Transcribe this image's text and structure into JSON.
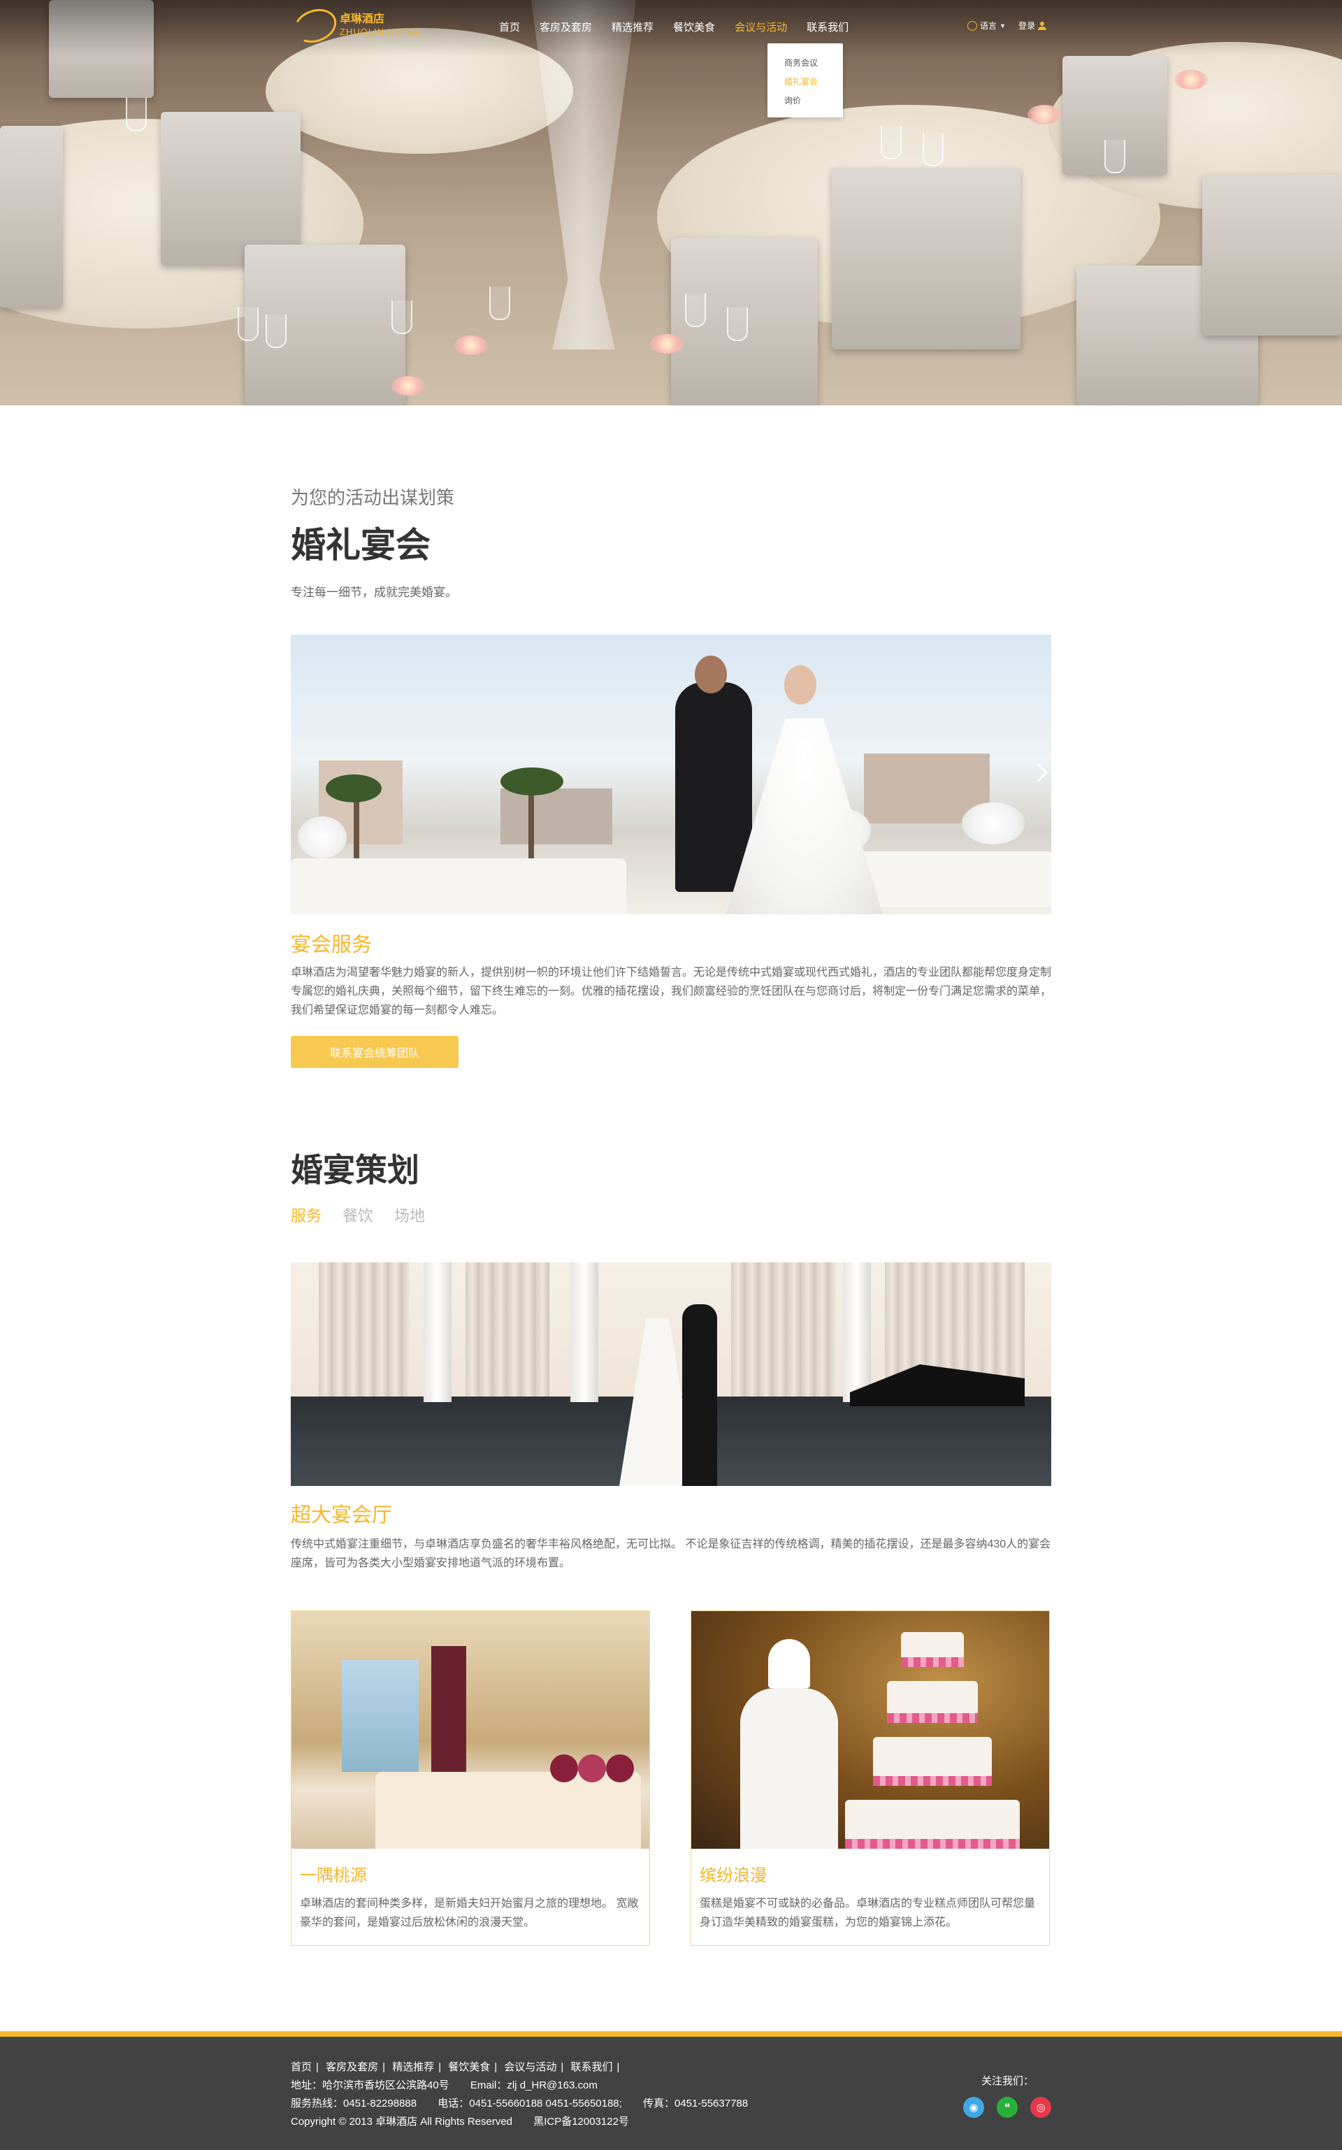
{
  "brand": {
    "logo_cn": "卓琳酒店",
    "logo_en": "ZHUOLIN HOTEL",
    "accent_color": "#f5b72c"
  },
  "nav": {
    "items": [
      "首页",
      "客房及套房",
      "精选推荐",
      "餐饮美食",
      "会议与活动",
      "联系我们"
    ],
    "active_index": 4,
    "dropdown": [
      "商务会议",
      "婚礼宴会",
      "询价"
    ],
    "dropdown_selected_index": 1,
    "language_label": "语言",
    "login_label": "登录"
  },
  "intro": {
    "subheading": "为您的活动出谋划策",
    "title": "婚礼宴会",
    "tagline": "专注每一细节，成就完美婚宴。"
  },
  "banquet": {
    "title": "宴会服务",
    "body": "卓琳酒店为渴望奢华魅力婚宴的新人，提供别树一帜的环境让他们许下结婚誓言。无论是传统中式婚宴或现代西式婚礼，酒店的专业团队都能帮您度身定制专属您的婚礼庆典，关照每个细节，留下终生难忘的一刻。优雅的插花摆设，我们颇富经验的烹饪团队在与您商讨后，将制定一份专门满足您需求的菜单，我们希望保证您婚宴的每一刻都令人难忘。",
    "button": "联系宴会统筹团队"
  },
  "planning": {
    "title": "婚宴策划",
    "tabs": [
      "服务",
      "餐饮",
      "场地"
    ],
    "active_tab": 0,
    "hall_title": "超大宴会厅",
    "hall_body": "传统中式婚宴注重细节，与卓琳酒店享负盛名的奢华丰裕风格绝配，无可比拟。 不论是象征吉祥的传统格调，精美的插花摆设，还是最多容纳430人的宴会座席，皆可为各类大小型婚宴安排地道气派的环境布置。"
  },
  "cards": [
    {
      "title": "一隅桃源",
      "body": "卓琳酒店的套间种类多样，是新婚夫妇开始蜜月之旅的理想地。 宽敞豪华的套间，是婚宴过后放松休闲的浪漫天堂。"
    },
    {
      "title": "缤纷浪漫",
      "body": "蛋糕是婚宴不可或缺的必备品。卓琳酒店的专业糕点师团队可帮您量身订造华美精致的婚宴蛋糕，为您的婚宴锦上添花。"
    }
  ],
  "footer": {
    "links": [
      "首页",
      "客房及套房",
      "精选推荐",
      "餐饮美食",
      "会议与活动",
      "联系我们"
    ],
    "address": "地址：哈尔滨市香坊区公滨路40号",
    "email": "Email：zlj d_HR@163.com",
    "hotline": "服务热线：0451-82298888",
    "phone": "电话：0451-55660188  0451-55650188;",
    "fax": "传真：0451-55637788",
    "copyright": "Copyright © 2013 卓琳酒店 All Rights Reserved",
    "icp": "黑ICP备12003122号",
    "follow": "关注我们：",
    "social_icons": [
      "qq-icon",
      "wechat-icon",
      "weibo-icon"
    ]
  }
}
